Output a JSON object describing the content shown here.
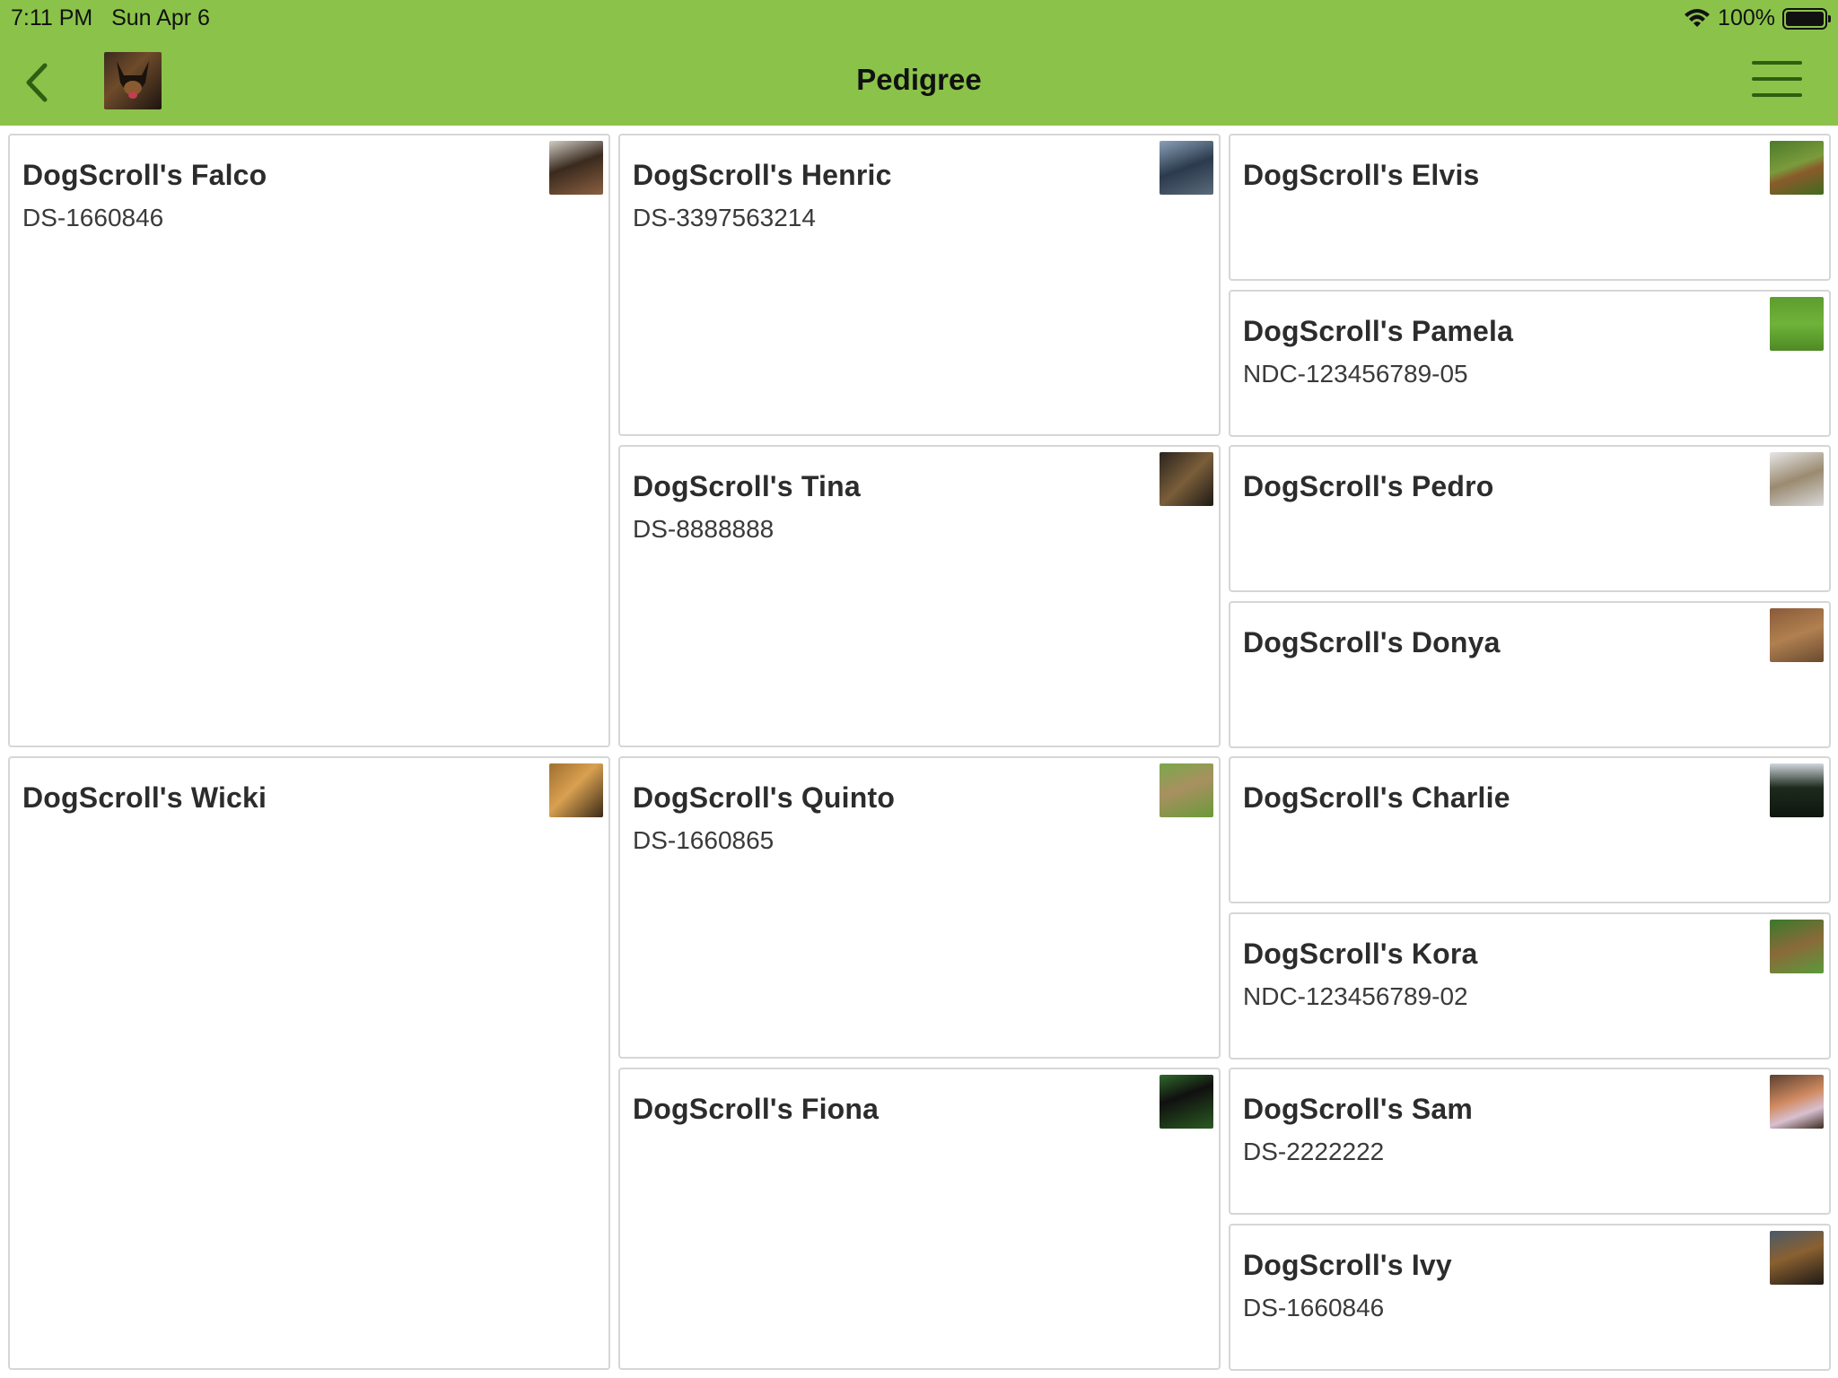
{
  "status_bar": {
    "time": "7:11 PM",
    "date": "Sun Apr 6",
    "battery": "100%",
    "battery_level": 1.0
  },
  "header": {
    "title": "Pedigree",
    "back_icon": "chevron-left-icon",
    "menu_icon": "hamburger-menu-icon",
    "accent_color": "#8bc34a"
  },
  "pedigree": {
    "sire": {
      "name": "DogScroll's Falco",
      "reg": "DS-1660846"
    },
    "dam": {
      "name": "DogScroll's Wicki",
      "reg": ""
    },
    "sire_sire": {
      "name": "DogScroll's Henric",
      "reg": "DS-3397563214"
    },
    "sire_dam": {
      "name": "DogScroll's Tina",
      "reg": "DS-8888888"
    },
    "dam_sire": {
      "name": "DogScroll's Quinto",
      "reg": "DS-1660865"
    },
    "dam_dam": {
      "name": "DogScroll's Fiona",
      "reg": ""
    },
    "ss_sire": {
      "name": "DogScroll's Elvis",
      "reg": ""
    },
    "ss_dam": {
      "name": "DogScroll's Pamela",
      "reg": "NDC-123456789-05"
    },
    "sd_sire": {
      "name": "DogScroll's Pedro",
      "reg": ""
    },
    "sd_dam": {
      "name": "DogScroll's Donya",
      "reg": ""
    },
    "ds_sire": {
      "name": "DogScroll's Charlie",
      "reg": ""
    },
    "ds_dam": {
      "name": "DogScroll's Kora",
      "reg": "NDC-123456789-02"
    },
    "dd_sire": {
      "name": "DogScroll's Sam",
      "reg": "DS-2222222"
    },
    "dd_dam": {
      "name": "DogScroll's Ivy",
      "reg": "DS-1660846"
    }
  }
}
